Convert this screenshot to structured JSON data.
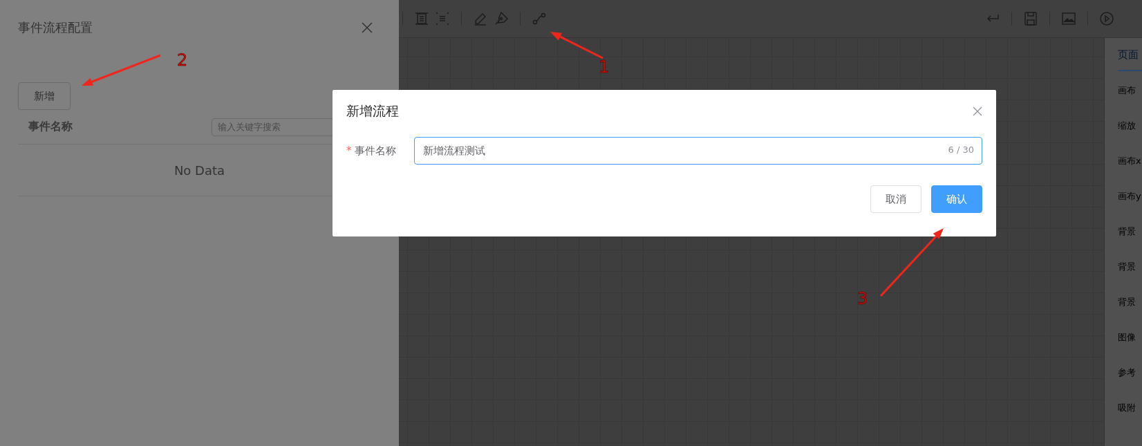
{
  "property_panel": {
    "tabs": [
      {
        "label": "页面",
        "selected": true
      }
    ],
    "items": [
      "画布",
      "缩放",
      "画布x",
      "画布y",
      "背景",
      "背景",
      "背景",
      "图像",
      "参考",
      "吸附"
    ]
  },
  "drawer": {
    "title": "事件流程配置",
    "add_button": "新增",
    "table": {
      "columns": [
        "事件名称"
      ],
      "search": {
        "placeholder": "输入关键字搜索"
      },
      "empty_text": "No Data"
    }
  },
  "dialog": {
    "title": "新增流程",
    "field": {
      "label": "事件名称",
      "required": true,
      "required_mark": "*",
      "value": "新增流程测试",
      "counter": "6 / 30"
    },
    "buttons": [
      {
        "label": "取消",
        "kind": "default"
      },
      {
        "label": "确认",
        "kind": "primary"
      }
    ]
  },
  "annotations": [
    {
      "label": "1"
    },
    {
      "label": "2"
    },
    {
      "label": "3"
    }
  ]
}
